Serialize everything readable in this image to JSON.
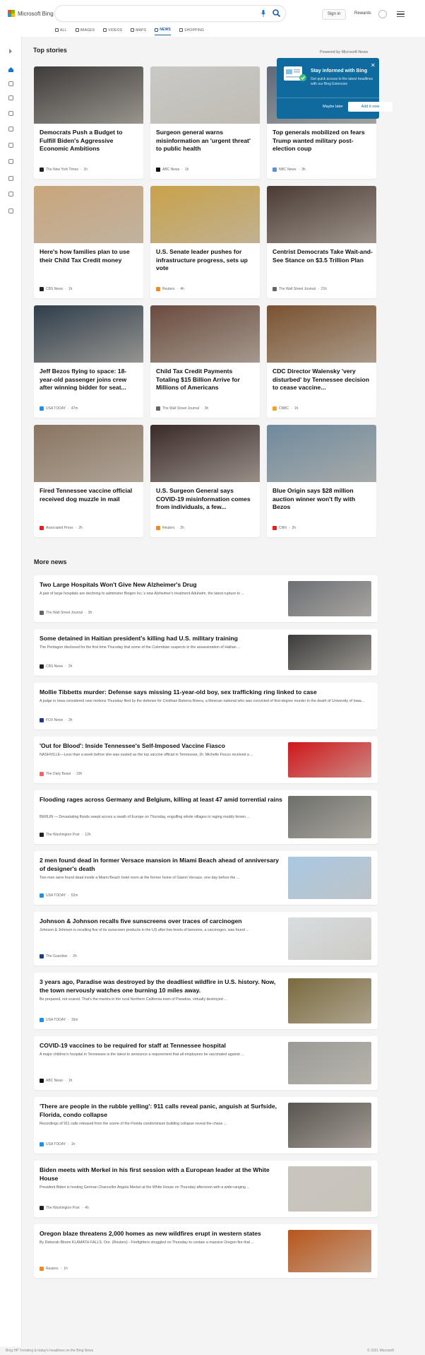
{
  "brand": {
    "name": "Microsoft Bing",
    "colors": [
      "#f25022",
      "#7fba00",
      "#00a4ef",
      "#ffb900"
    ]
  },
  "header": {
    "signin_label": "Sign in",
    "rewards_label": "Rewards",
    "icons": [
      "mic-icon",
      "search-icon",
      "trophy-icon",
      "hamburger-menu-icon"
    ]
  },
  "tabs": [
    {
      "label": "ALL",
      "icon": "search-icon"
    },
    {
      "label": "IMAGES",
      "icon": "image-icon"
    },
    {
      "label": "VIDEOS",
      "icon": "video-icon"
    },
    {
      "label": "MAPS",
      "icon": "map-pin-icon"
    },
    {
      "label": "NEWS",
      "icon": "news-icon",
      "active": true
    },
    {
      "label": "SHOPPING",
      "icon": "tag-icon"
    }
  ],
  "sidebar": {
    "icons": [
      "expand-arrow-icon",
      "home-icon",
      "tools-icon",
      "flag-icon",
      "location-icon",
      "globe-icon",
      "microscope-icon",
      "rocket-icon",
      "film-icon",
      "bank-icon",
      "card-icon"
    ]
  },
  "top_stories": {
    "title": "Top stories",
    "powered": "Powered by Microsoft News",
    "cards": [
      {
        "title": "Democrats Push a Budget to Fulfill Biden's Aggressive Economic Ambitions",
        "source": "The New York Times",
        "age": "1h",
        "img": "#3e3b3a",
        "logo": "#222"
      },
      {
        "title": "Surgeon general warns misinformation an 'urgent threat' to public health",
        "source": "ABC News",
        "age": "1h",
        "img": "#c9c9c6",
        "logo": "#111"
      },
      {
        "title": "Top generals mobilized on fears Trump wanted military post-election coup",
        "source": "NBC News",
        "age": "3h",
        "img": "#5d6a7a",
        "logo": "#5a8fd1"
      },
      {
        "title": "Here's how families plan to use their Child Tax Credit money",
        "source": "CBS News",
        "age": "1h",
        "img": "#c9a67c",
        "logo": "#222"
      },
      {
        "title": "U.S. Senate leader pushes for infrastructure progress, sets up vote",
        "source": "Reuters",
        "age": "4h",
        "img": "#c9a24a",
        "logo": "#f08a22"
      },
      {
        "title": "Centrist Democrats Take Wait-and-See Stance on $3.5 Trillion Plan",
        "source": "The Wall Street Journal",
        "age": "21h",
        "img": "#4a3a35",
        "logo": "#666"
      },
      {
        "title": "Jeff Bezos flying to space: 18-year-old passenger joins crew after winning bidder for seat...",
        "source": "USA TODAY",
        "age": "47m",
        "img": "#2f3d4a",
        "logo": "#1e90e8"
      },
      {
        "title": "Child Tax Credit Payments Totaling $15 Billion Arrive for Millions of Americans",
        "source": "The Wall Street Journal",
        "age": "3h",
        "img": "#6a4b3e",
        "logo": "#666"
      },
      {
        "title": "CDC Director Walensky 'very disturbed' by Tennessee decision to cease vaccine...",
        "source": "CNBC",
        "age": "1h",
        "img": "#7a5230",
        "logo": "#f2a12b"
      },
      {
        "title": "Fired Tennessee vaccine official received dog muzzle in mail",
        "source": "Associated Press",
        "age": "2h",
        "img": "#8a7460",
        "logo": "#d22"
      },
      {
        "title": "U.S. Surgeon General says COVID-19 misinformation comes from individuals, a few...",
        "source": "Reuters",
        "age": "2h",
        "img": "#3a2a28",
        "logo": "#f08a22"
      },
      {
        "title": "Blue Origin says $28 million auction winner won't fly with Bezos",
        "source": "CNN",
        "age": "2h",
        "img": "#6f8a9e",
        "logo": "#d22"
      }
    ]
  },
  "popup": {
    "title": "Stay informed with Bing",
    "text": "Get quick access to the latest headlines with our Bing Extension",
    "later_label": "Maybe later",
    "add_label": "Add it now",
    "close": "✕"
  },
  "more_news": {
    "title": "More news",
    "items": [
      {
        "title": "Two Large Hospitals Won't Give New Alzheimer's Drug",
        "snippet": "A pair of large hospitals are declining to administer Biogen Inc.'s new Alzheimer's treatment Aduhelm, the latest rupture to ...",
        "source": "The Wall Street Journal",
        "age": "3h",
        "img": "#6b6e74",
        "logo": "#666",
        "h": 66,
        "lines": 1
      },
      {
        "title": "Some detained in Haitian president's killing had U.S. military training",
        "snippet": "The Pentagon disclosed for the first time Thursday that some of the Colombian suspects in the assassination of Haitian ...",
        "source": "CBS News",
        "age": "2h",
        "img": "#3c3c3c",
        "logo": "#222",
        "h": 66,
        "lines": 1
      },
      {
        "title": "Mollie Tibbetts murder: Defense says missing 11-year-old boy, sex trafficking ring linked to case",
        "snippet": "A judge in Iowa considered new motions Thursday filed by the defense for Cristhian Bahena Rivera, a Mexican national who was convicted of first-degree murder in the death of University of Iowa...",
        "source": "FOX News",
        "age": "3h",
        "img": "",
        "logo": "#1b3b8a",
        "h": 66,
        "lines": 1
      },
      {
        "title": "'Out for Blood': Inside Tennessee's Self-Imposed Vaccine Fiasco",
        "snippet": "NASHVILLE—Less than a week before she was ousted as the top vaccine official in Tennessee, Dr. Michelle Fiscus received a ...",
        "source": "The Daily Beast",
        "age": "19h",
        "img": "#d0161a",
        "logo": "#e66",
        "h": 66,
        "lines": 1
      },
      {
        "title": "Flooding rages across Germany and Belgium, killing at least 47 amid torrential rains",
        "snippet": "BERLIN — Devastating floods swept across a swath of Europe on Thursday, engulfing whole villages in raging muddy brown ...",
        "source": "The Washington Post",
        "age": "12h",
        "img": "#6e6f6a",
        "logo": "#222",
        "h": 76,
        "lines": 2
      },
      {
        "title": "2 men found dead in former Versace mansion in Miami Beach ahead of anniversary of designer's death",
        "snippet": "Two men were found dead inside a Miami Beach hotel room at the former home of Gianni Versace, one day before the ...",
        "source": "USA TODAY",
        "age": "52m",
        "img": "#a9c8e4",
        "logo": "#1e90e8",
        "h": 76,
        "lines": 2
      },
      {
        "title": "Johnson & Johnson recalls five sunscreens over traces of carcinogen",
        "snippet": "Johnson & Johnson is recalling five of its sunscreen products in the US after low levels of benzene, a carcinogen, was found ...",
        "source": "The Guardian",
        "age": "2h",
        "img": "#d8dde0",
        "logo": "#1b3b8a",
        "h": 76,
        "lines": 1
      },
      {
        "title": "3 years ago, Paradise was destroyed by the deadliest wildfire in U.S. history. Now, the town nervously watches one burning 10 miles away.",
        "snippet": "Be prepared, not scared. That's the mantra in the rural Northern California town of Paradise, virtually destroyed ...",
        "source": "USA TODAY",
        "age": "15m",
        "img": "#7a6a3e",
        "logo": "#1e90e8",
        "h": 80,
        "lines": 2
      },
      {
        "title": "COVID-19 vaccines to be required for staff at Tennessee hospital",
        "snippet": "A major children's hospital in Tennessee is the latest to announce a requirement that all employees be vaccinated against ...",
        "source": "ABC News",
        "age": "1h",
        "img": "#9a9a96",
        "logo": "#111",
        "h": 76,
        "lines": 1
      },
      {
        "title": "'There are people in the rubble yelling': 911 calls reveal panic, anguish at Surfside, Florida, condo collapse",
        "snippet": "Recordings of 911 calls released from the scene of the Florida condominium building collapse reveal the chaos ...",
        "source": "USA TODAY",
        "age": "1h",
        "img": "#5a5450",
        "logo": "#1e90e8",
        "h": 80,
        "lines": 2
      },
      {
        "title": "Biden meets with Merkel in his first session with a European leader at the White House",
        "snippet": "President Biden is hosting German Chancellor Angela Merkel at the White House on Thursday afternoon with a wide-ranging ...",
        "source": "The Washington Post",
        "age": "4h",
        "img": "#c9c5bd",
        "logo": "#222",
        "h": 80,
        "lines": 2
      },
      {
        "title": "Oregon blaze threatens 2,000 homes as new wildfires erupt in western states",
        "snippet": "By Deborah Bloom KLAMATH FALLS, Ore. (Reuters) - Firefighters struggled on Thursday to contain a massive Oregon fire that ...",
        "source": "Reuters",
        "age": "1h",
        "img": "#b8561c",
        "logo": "#f08a22",
        "h": 76,
        "lines": 1
      }
    ]
  },
  "footer": {
    "left": "Bing HP  Trending & today's headlines on the Bing News",
    "right": "© 2021 Microsoft"
  }
}
